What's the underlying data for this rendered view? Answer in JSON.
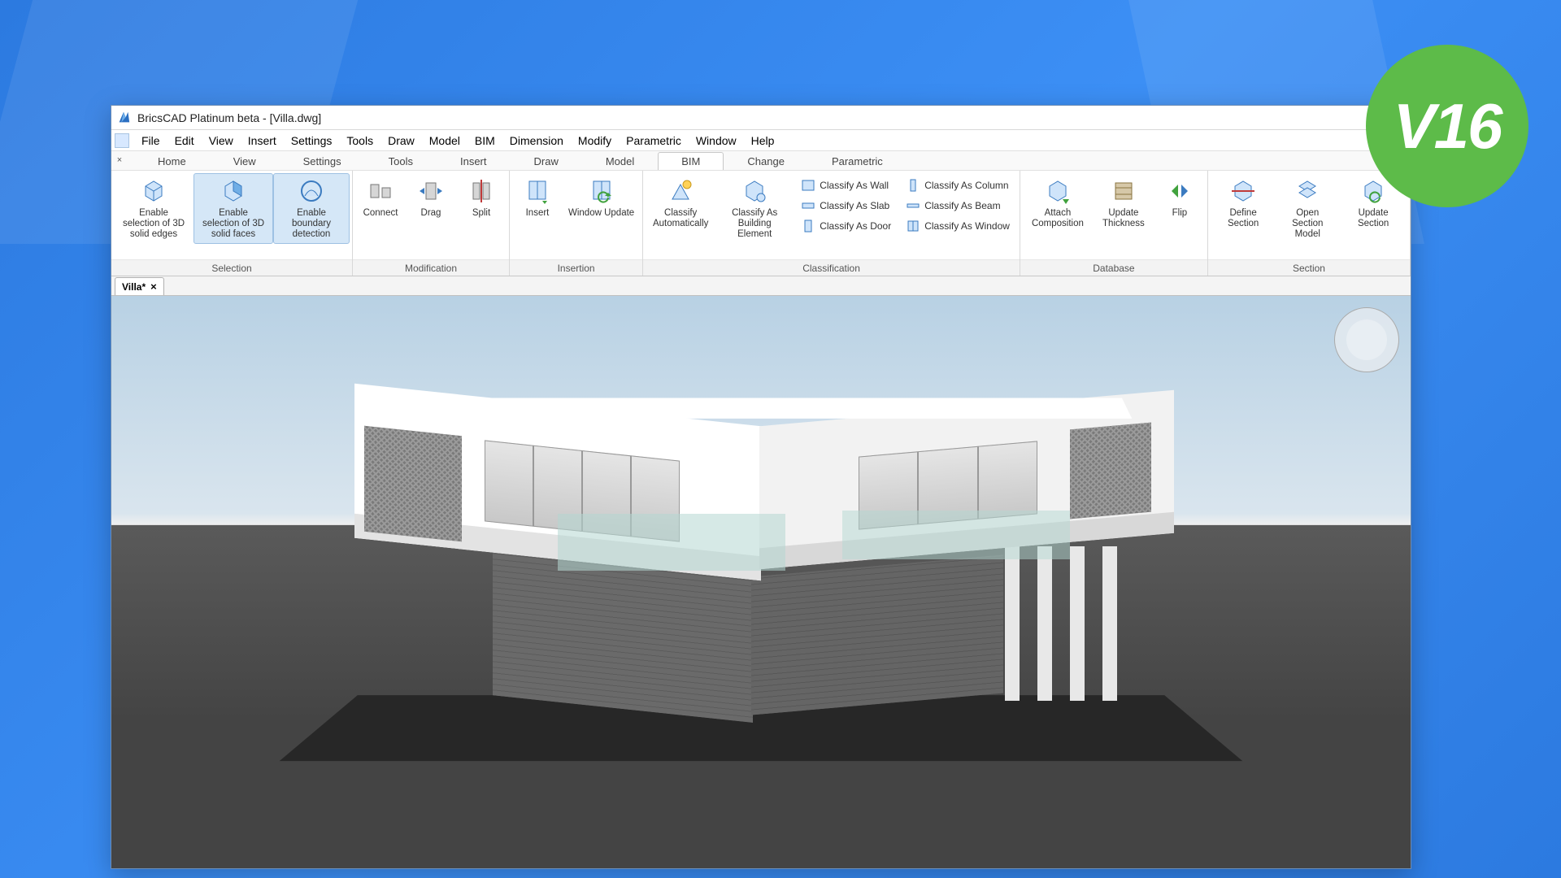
{
  "version_badge": "V16",
  "window": {
    "title": "BricsCAD Platinum beta - [Villa.dwg]"
  },
  "menu": [
    "File",
    "Edit",
    "View",
    "Insert",
    "Settings",
    "Tools",
    "Draw",
    "Model",
    "BIM",
    "Dimension",
    "Modify",
    "Parametric",
    "Window",
    "Help"
  ],
  "ribbon_tabs": [
    "Home",
    "View",
    "Settings",
    "Tools",
    "Insert",
    "Draw",
    "Model",
    "BIM",
    "Change",
    "Parametric"
  ],
  "ribbon_active_tab": "BIM",
  "doc_tab": {
    "label": "Villa*",
    "close": "×"
  },
  "ribbon": {
    "selection": {
      "title": "Selection",
      "btns": [
        {
          "label": "Enable selection of 3D solid edges"
        },
        {
          "label": "Enable selection of 3D solid faces"
        },
        {
          "label": "Enable boundary detection"
        }
      ]
    },
    "modification": {
      "title": "Modification",
      "btns": [
        {
          "label": "Connect"
        },
        {
          "label": "Drag"
        },
        {
          "label": "Split"
        }
      ]
    },
    "insertion": {
      "title": "Insertion",
      "btns": [
        {
          "label": "Insert"
        },
        {
          "label": "Window Update"
        }
      ]
    },
    "classification": {
      "title": "Classification",
      "big": [
        {
          "label": "Classify Automatically"
        },
        {
          "label": "Classify As Building Element"
        }
      ],
      "small_col1": [
        {
          "label": "Classify As Wall"
        },
        {
          "label": "Classify As Slab"
        },
        {
          "label": "Classify As Door"
        }
      ],
      "small_col2": [
        {
          "label": "Classify As Column"
        },
        {
          "label": "Classify As Beam"
        },
        {
          "label": "Classify As Window"
        }
      ]
    },
    "database": {
      "title": "Database",
      "btns": [
        {
          "label": "Attach Composition"
        },
        {
          "label": "Update Thickness"
        },
        {
          "label": "Flip"
        }
      ]
    },
    "section": {
      "title": "Section",
      "btns": [
        {
          "label": "Define Section"
        },
        {
          "label": "Open Section Model"
        },
        {
          "label": "Update Section"
        }
      ]
    }
  }
}
